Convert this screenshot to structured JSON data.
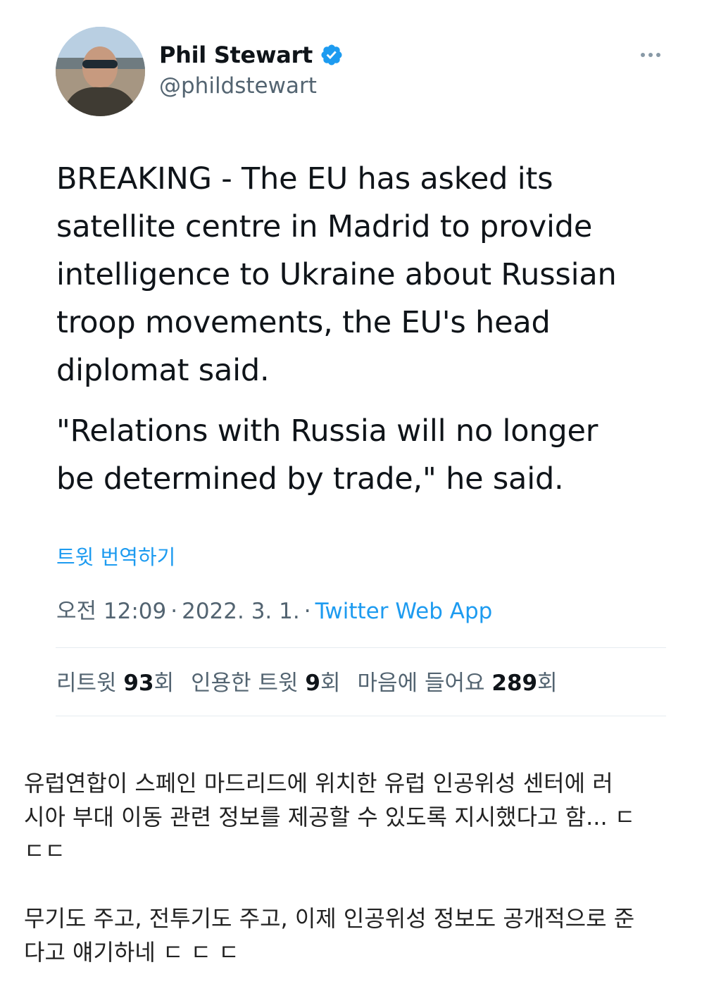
{
  "tweet": {
    "author": {
      "display_name": "Phil Stewart",
      "handle": "@phildstewart",
      "verified": true
    },
    "paragraphs": [
      "BREAKING - The EU has asked its\nsatellite centre in Madrid to provide\nintelligence to Ukraine about Russian\ntroop movements, the EU's head\ndiplomat said.",
      "\"Relations with Russia will no longer\nbe determined by trade,\" he said."
    ],
    "translate_label": "트윗 번역하기",
    "time": "오전 12:09",
    "date": "2022. 3. 1.",
    "separator": "·",
    "source": "Twitter Web App",
    "stats": {
      "retweets_label": "리트윗",
      "retweets_count": "93",
      "quotes_label": "인용한 트윗",
      "quotes_count": "9",
      "likes_label": "마음에 들어요",
      "likes_count": "289",
      "suffix": "회"
    }
  },
  "comment": {
    "paragraphs": [
      "유럽연합이 스페인 마드리드에 위치한 유럽 인공위성 센터에 러\n시아 부대 이동 관련 정보를 제공할 수 있도록 지시했다고 함... ㄷ\nㄷㄷ",
      "무기도 주고, 전투기도 주고, 이제 인공위성 정보도 공개적으로 준\n다고 얘기하네 ㄷ ㄷ ㄷ"
    ]
  },
  "colors": {
    "link": "#1d9bf0",
    "muted": "#536471",
    "text": "#0f1419",
    "verified": "#1d9bf0"
  },
  "icons": {
    "verified": "verified-badge-icon",
    "more": "more-horizontal-icon"
  }
}
